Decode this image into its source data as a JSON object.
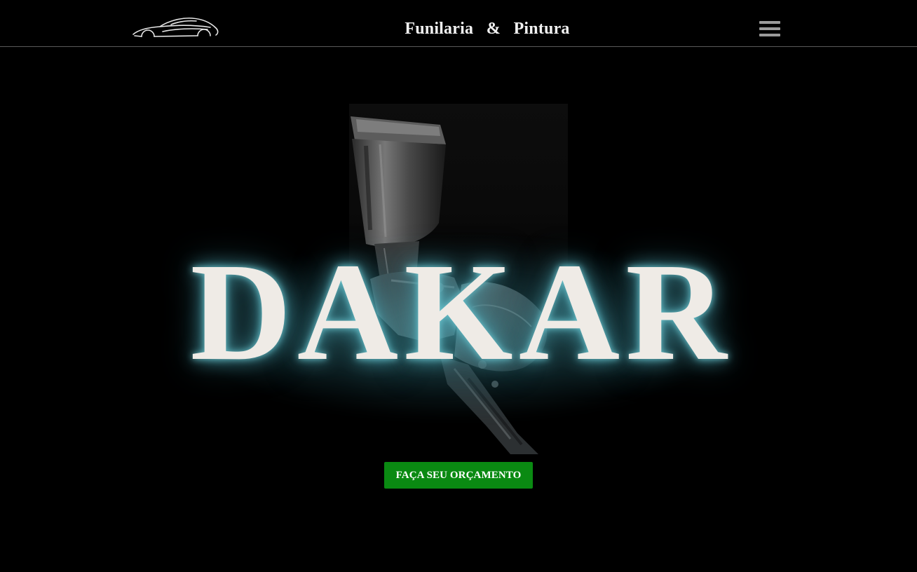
{
  "header": {
    "logo_icon": "car-silhouette-icon",
    "title": "Funilaria   &   Pintura",
    "menu_icon": "hamburger-menu-icon"
  },
  "hero": {
    "image": "spray-paint-gun-photo",
    "brand": "DAKAR",
    "cta_label": "FAÇA SEU ORÇAMENTO"
  },
  "colors": {
    "background": "#000000",
    "header_border": "#5a5a5a",
    "title_text": "#efebe6",
    "title_glow": "#50aab9",
    "cta_background": "#0a8a12",
    "cta_text": "#ffffff",
    "menu_icon": "#9b9b9b"
  }
}
